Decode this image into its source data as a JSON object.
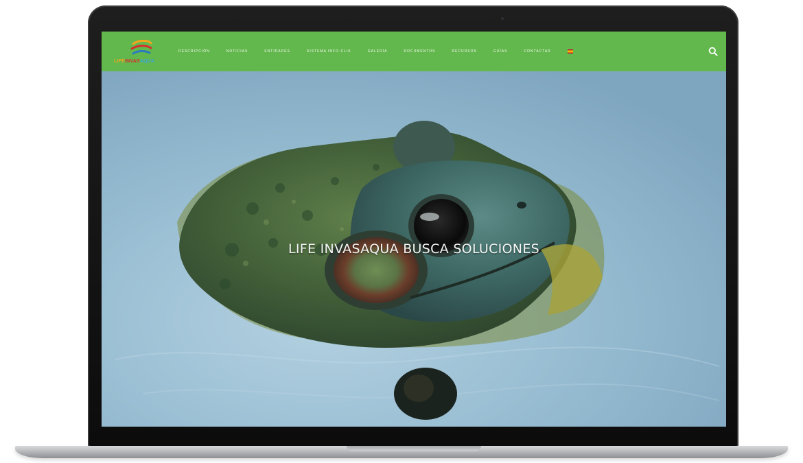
{
  "site": {
    "logo_text": {
      "part1": "LIFE",
      "part2": "INVAS",
      "part3": "AQUA"
    },
    "brand_color": "#63b84d"
  },
  "nav": {
    "items": [
      {
        "label": "DESCRIPCIÓN"
      },
      {
        "label": "NOTICIAS"
      },
      {
        "label": "ENTIDADES"
      },
      {
        "label": "SISTEMA INFO-CLIK"
      },
      {
        "label": "GALERÍA"
      },
      {
        "label": "DOCUMENTOS"
      },
      {
        "label": "RECURSOS"
      },
      {
        "label": "GUÍAS"
      },
      {
        "label": "CONTACTAR"
      }
    ],
    "language_flag": "spain-flag-icon",
    "search_icon": "search-icon"
  },
  "hero": {
    "title": "LIFE INVASAQUA BUSCA SOLUCIONES",
    "image": "frog-in-water-photo"
  }
}
